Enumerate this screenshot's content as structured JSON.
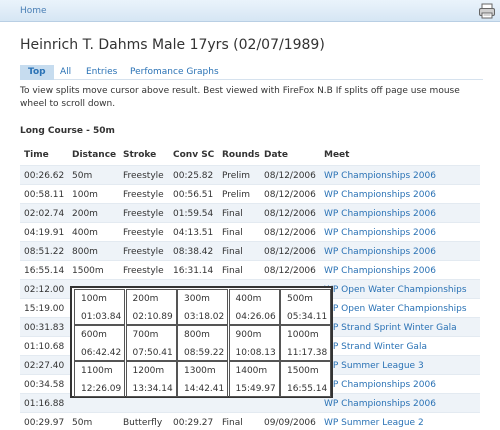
{
  "nav": {
    "home": "Home"
  },
  "athlete": {
    "title": "Heinrich T. Dahms  Male  17yrs  (02/07/1989)"
  },
  "tabs": [
    {
      "label": "Top",
      "active": true
    },
    {
      "label": "All",
      "active": false
    },
    {
      "label": "Entries",
      "active": false
    },
    {
      "label": "Perfomance Graphs",
      "active": false
    }
  ],
  "note": "To view splits move cursor above result. Best viewed with FireFox N.B If splits off page use mouse wheel to scroll down.",
  "section": "Long Course - 50m",
  "columns": [
    "Time",
    "Distance",
    "Stroke",
    "Conv SC",
    "Rounds",
    "Date",
    "Meet"
  ],
  "rows": [
    {
      "time": "00:26.62",
      "distance": "50m",
      "stroke": "Freestyle",
      "conv": "00:25.82",
      "rounds": "Prelim",
      "date": "08/12/2006",
      "meet": "WP Championships 2006"
    },
    {
      "time": "00:58.11",
      "distance": "100m",
      "stroke": "Freestyle",
      "conv": "00:56.51",
      "rounds": "Prelim",
      "date": "08/12/2006",
      "meet": "WP Championships 2006"
    },
    {
      "time": "02:02.74",
      "distance": "200m",
      "stroke": "Freestyle",
      "conv": "01:59.54",
      "rounds": "Final",
      "date": "08/12/2006",
      "meet": "WP Championships 2006"
    },
    {
      "time": "04:19.91",
      "distance": "400m",
      "stroke": "Freestyle",
      "conv": "04:13.51",
      "rounds": "Final",
      "date": "08/12/2006",
      "meet": "WP Championships 2006"
    },
    {
      "time": "08:51.22",
      "distance": "800m",
      "stroke": "Freestyle",
      "conv": "08:38.42",
      "rounds": "Final",
      "date": "08/12/2006",
      "meet": "WP Championships 2006"
    },
    {
      "time": "16:55.14",
      "distance": "1500m",
      "stroke": "Freestyle",
      "conv": "16:31.14",
      "rounds": "Final",
      "date": "08/12/2006",
      "meet": "WP Championships 2006"
    },
    {
      "time": "02:12.00",
      "distance": "",
      "stroke": "",
      "conv": "",
      "rounds": "",
      "date": "",
      "meet": "WP Open Water Championships"
    },
    {
      "time": "15:19.00",
      "distance": "",
      "stroke": "",
      "conv": "",
      "rounds": "",
      "date": "",
      "meet": "WP Open Water Championships"
    },
    {
      "time": "00:31.83",
      "distance": "",
      "stroke": "",
      "conv": "",
      "rounds": "",
      "date": "",
      "meet": "WP Strand Sprint Winter Gala"
    },
    {
      "time": "01:10.68",
      "distance": "",
      "stroke": "",
      "conv": "",
      "rounds": "",
      "date": "",
      "meet": "WP Strand Winter Gala"
    },
    {
      "time": "02:27.40",
      "distance": "",
      "stroke": "",
      "conv": "",
      "rounds": "",
      "date": "",
      "meet": "WP Summer League 3"
    },
    {
      "time": "00:34.58",
      "distance": "",
      "stroke": "",
      "conv": "",
      "rounds": "",
      "date": "",
      "meet": "WP Championships 2006"
    },
    {
      "time": "01:16.88",
      "distance": "",
      "stroke": "",
      "conv": "",
      "rounds": "",
      "date": "",
      "meet": "WP Championships 2006"
    },
    {
      "time": "00:29.97",
      "distance": "50m",
      "stroke": "Butterfly",
      "conv": "00:29.27",
      "rounds": "Final",
      "date": "09/09/2006",
      "meet": "WP Summer League 2"
    }
  ],
  "splits": [
    {
      "distance": "100m",
      "time": "01:03.84"
    },
    {
      "distance": "200m",
      "time": "02:10.89"
    },
    {
      "distance": "300m",
      "time": "03:18.02"
    },
    {
      "distance": "400m",
      "time": "04:26.06"
    },
    {
      "distance": "500m",
      "time": "05:34.11"
    },
    {
      "distance": "600m",
      "time": "06:42.42"
    },
    {
      "distance": "700m",
      "time": "07:50.41"
    },
    {
      "distance": "800m",
      "time": "08:59.22"
    },
    {
      "distance": "900m",
      "time": "10:08.13"
    },
    {
      "distance": "1000m",
      "time": "11:17.38"
    },
    {
      "distance": "1100m",
      "time": "12:26.09"
    },
    {
      "distance": "1200m",
      "time": "13:34.14"
    },
    {
      "distance": "1300m",
      "time": "14:42.41"
    },
    {
      "distance": "1400m",
      "time": "15:49.97"
    },
    {
      "distance": "1500m",
      "time": "16:55.14"
    }
  ],
  "icons": {
    "print": "printer-icon"
  },
  "colors": {
    "link": "#2a72b5",
    "tab_active_bg": "#c6dcef",
    "alt_row": "#eef3f8"
  }
}
